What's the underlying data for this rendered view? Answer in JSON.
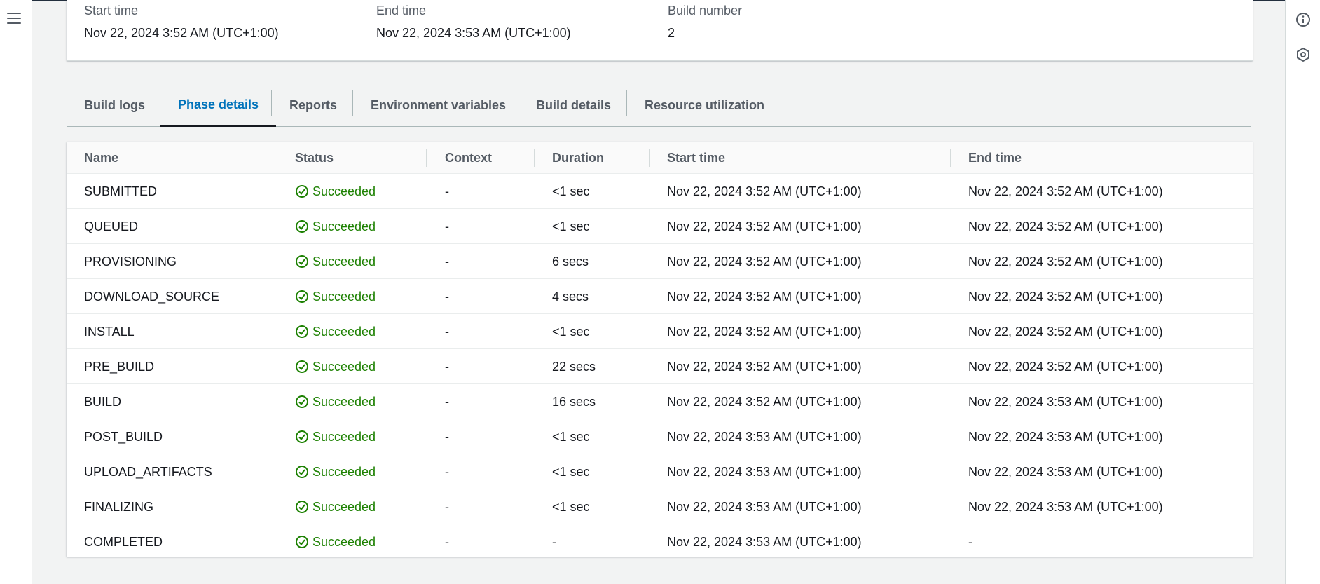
{
  "summary": {
    "start_time_label": "Start time",
    "start_time_value": "Nov 22, 2024 3:52 AM (UTC+1:00)",
    "end_time_label": "End time",
    "end_time_value": "Nov 22, 2024 3:53 AM (UTC+1:00)",
    "build_number_label": "Build number",
    "build_number_value": "2"
  },
  "tabs": [
    {
      "label": "Build logs"
    },
    {
      "label": "Phase details"
    },
    {
      "label": "Reports"
    },
    {
      "label": "Environment variables"
    },
    {
      "label": "Build details"
    },
    {
      "label": "Resource utilization"
    }
  ],
  "active_tab": "Phase details",
  "table": {
    "headers": [
      "Name",
      "Status",
      "Context",
      "Duration",
      "Start time",
      "End time"
    ],
    "rows": [
      {
        "name": "SUBMITTED",
        "status": "Succeeded",
        "context": "-",
        "duration": "<1 sec",
        "start": "Nov 22, 2024 3:52 AM (UTC+1:00)",
        "end": "Nov 22, 2024 3:52 AM (UTC+1:00)"
      },
      {
        "name": "QUEUED",
        "status": "Succeeded",
        "context": "-",
        "duration": "<1 sec",
        "start": "Nov 22, 2024 3:52 AM (UTC+1:00)",
        "end": "Nov 22, 2024 3:52 AM (UTC+1:00)"
      },
      {
        "name": "PROVISIONING",
        "status": "Succeeded",
        "context": "-",
        "duration": "6 secs",
        "start": "Nov 22, 2024 3:52 AM (UTC+1:00)",
        "end": "Nov 22, 2024 3:52 AM (UTC+1:00)"
      },
      {
        "name": "DOWNLOAD_SOURCE",
        "status": "Succeeded",
        "context": "-",
        "duration": "4 secs",
        "start": "Nov 22, 2024 3:52 AM (UTC+1:00)",
        "end": "Nov 22, 2024 3:52 AM (UTC+1:00)"
      },
      {
        "name": "INSTALL",
        "status": "Succeeded",
        "context": "-",
        "duration": "<1 sec",
        "start": "Nov 22, 2024 3:52 AM (UTC+1:00)",
        "end": "Nov 22, 2024 3:52 AM (UTC+1:00)"
      },
      {
        "name": "PRE_BUILD",
        "status": "Succeeded",
        "context": "-",
        "duration": "22 secs",
        "start": "Nov 22, 2024 3:52 AM (UTC+1:00)",
        "end": "Nov 22, 2024 3:52 AM (UTC+1:00)"
      },
      {
        "name": "BUILD",
        "status": "Succeeded",
        "context": "-",
        "duration": "16 secs",
        "start": "Nov 22, 2024 3:52 AM (UTC+1:00)",
        "end": "Nov 22, 2024 3:53 AM (UTC+1:00)"
      },
      {
        "name": "POST_BUILD",
        "status": "Succeeded",
        "context": "-",
        "duration": "<1 sec",
        "start": "Nov 22, 2024 3:53 AM (UTC+1:00)",
        "end": "Nov 22, 2024 3:53 AM (UTC+1:00)"
      },
      {
        "name": "UPLOAD_ARTIFACTS",
        "status": "Succeeded",
        "context": "-",
        "duration": "<1 sec",
        "start": "Nov 22, 2024 3:53 AM (UTC+1:00)",
        "end": "Nov 22, 2024 3:53 AM (UTC+1:00)"
      },
      {
        "name": "FINALIZING",
        "status": "Succeeded",
        "context": "-",
        "duration": "<1 sec",
        "start": "Nov 22, 2024 3:53 AM (UTC+1:00)",
        "end": "Nov 22, 2024 3:53 AM (UTC+1:00)"
      },
      {
        "name": "COMPLETED",
        "status": "Succeeded",
        "context": "-",
        "duration": "-",
        "start": "Nov 22, 2024 3:53 AM (UTC+1:00)",
        "end": "-"
      }
    ]
  },
  "icons": {
    "menu": "hamburger-menu-icon",
    "info": "info-icon",
    "settings": "hexagon-settings-icon",
    "status": "check-circle-icon"
  },
  "colors": {
    "success": "#1d8102",
    "active_tab": "#0073bb",
    "background": "#f2f3f3"
  }
}
